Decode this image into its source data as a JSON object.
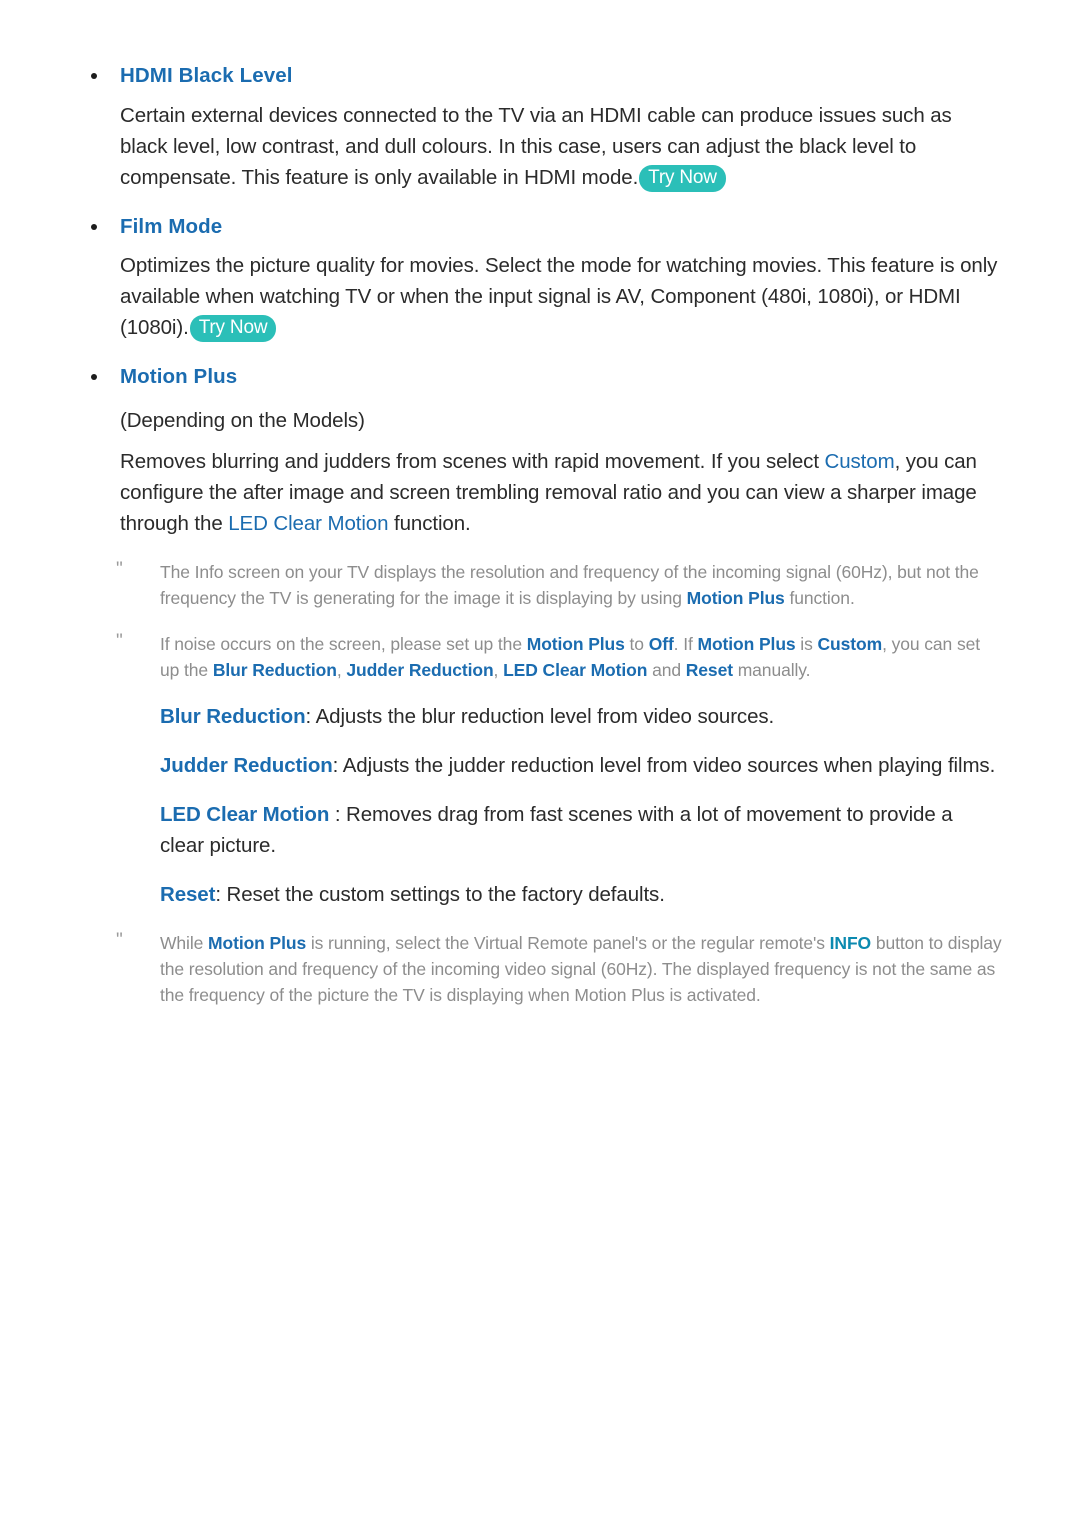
{
  "document": {
    "sections": [
      {
        "id": "hdmi-black-level",
        "heading": "HDMI Black Level",
        "body_before_badge": "Certain external devices connected to the TV via an HDMI cable can produce issues such as black level, low contrast, and dull colours. In this case, users can adjust the black level to compensate. This feature is only available in HDMI mode.",
        "badge": "Try Now"
      },
      {
        "id": "film-mode",
        "heading": "Film Mode",
        "body_before_badge": "Optimizes the picture quality for movies. Select the mode for watching movies. This feature is only available when watching TV or when the input signal is AV, Component (480i, 1080i), or HDMI (1080i).",
        "badge": "Try Now"
      },
      {
        "id": "motion-plus",
        "heading": "Motion Plus",
        "subnote": "(Depending on the Models)",
        "body_part1": "Removes blurring and judders from scenes with rapid movement. If you select ",
        "body_hl1": "Custom",
        "body_part2": ", you can configure the after image and screen trembling removal ratio and you can view a sharper image through the ",
        "body_hl2": "LED Clear Motion",
        "body_part3": " function."
      }
    ],
    "notes": [
      {
        "id": "note-info-screen",
        "marker": "\"",
        "p1": "The Info screen on your TV displays the resolution and frequency of the incoming signal (60Hz), but not the frequency the TV is generating for the image it is displaying by using ",
        "b1": "Motion Plus",
        "p2": " function."
      },
      {
        "id": "note-noise",
        "marker": "\"",
        "p1": "If noise occurs on the screen, please set up the ",
        "b1": "Motion Plus",
        "p2": " to ",
        "b2": "Off",
        "p3": ". If ",
        "b3": "Motion Plus",
        "p4": " is ",
        "b4": "Custom",
        "p5": ", you can set up the ",
        "b5": "Blur Reduction",
        "p6": ", ",
        "b6": "Judder Reduction",
        "p7": ", ",
        "b7": "LED Clear Motion",
        "p8": " and ",
        "b8": "Reset",
        "p9": " manually."
      }
    ],
    "definitions": [
      {
        "id": "def-blur-reduction",
        "term": "Blur Reduction",
        "separator": ": ",
        "description": "Adjusts the blur reduction level from video sources."
      },
      {
        "id": "def-judder-reduction",
        "term": "Judder Reduction",
        "separator": ": ",
        "description": "Adjusts the judder reduction level from video sources when playing films."
      },
      {
        "id": "def-led-clear-motion",
        "term": "LED Clear Motion",
        "separator": " : ",
        "description": "Removes drag from fast scenes with a lot of movement to provide a clear picture."
      },
      {
        "id": "def-reset",
        "term": "Reset",
        "separator": ": ",
        "description": "Reset the custom settings to the factory defaults."
      }
    ],
    "final_note": {
      "id": "note-virtual-remote",
      "marker": "\"",
      "p1": "While ",
      "b1": "Motion Plus",
      "p2": " is running, select the Virtual Remote panel's or the regular remote's ",
      "b2": "INFO",
      "p3": " button to display the resolution and frequency of the incoming video signal (60Hz). The displayed frequency is not the same as the frequency of the picture the TV is displaying when Motion Plus is activated."
    }
  },
  "colors": {
    "heading_blue": "#1b6cb0",
    "inline_blue": "#1b6cb0",
    "info_teal": "#0b8ab0",
    "badge_teal": "#2bbfb8",
    "body_text": "#2b2b2b",
    "note_text": "#8d8d8d",
    "page_background": "#ffffff"
  }
}
